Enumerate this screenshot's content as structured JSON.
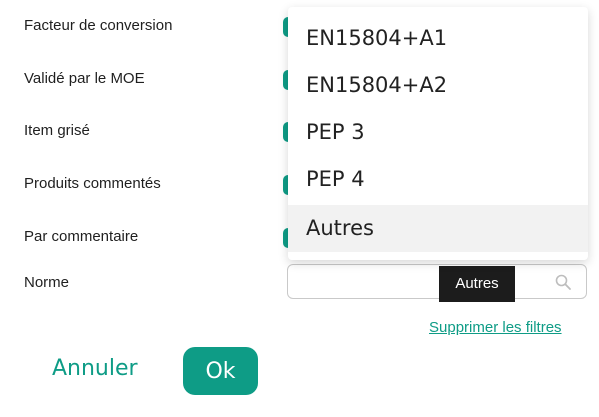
{
  "filters": {
    "labels": [
      "Facteur de conversion",
      "Validé par le MOE",
      "Item grisé",
      "Produits commentés",
      "Par commentaire",
      "Norme"
    ]
  },
  "norme": {
    "search_value": "",
    "tooltip": "Autres",
    "options": [
      "EN15804+A1",
      "EN15804+A2",
      "PEP 3",
      "PEP 4",
      "Autres"
    ],
    "highlighted_option": "Autres"
  },
  "actions": {
    "clear_filters": "Supprimer les filtres",
    "cancel": "Annuler",
    "ok": "Ok"
  },
  "colors": {
    "accent": "#0e9c86",
    "tooltip_bg": "#1c1c1c",
    "highlight_bg": "#f2f2f2"
  },
  "icons": {
    "search": "search-icon"
  }
}
